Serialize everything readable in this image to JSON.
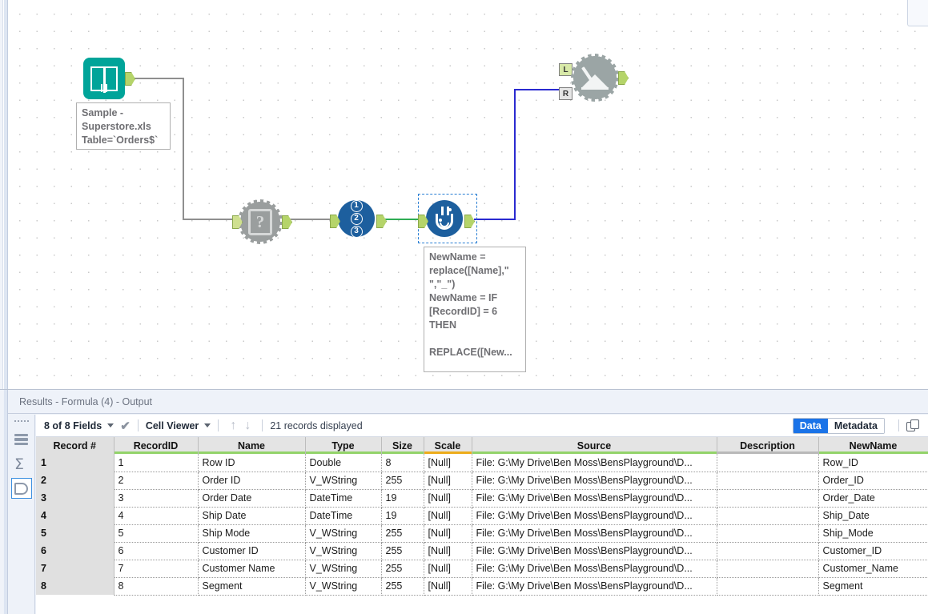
{
  "canvas": {
    "tools": [
      {
        "id": "input-data",
        "icon_name": "book-icon",
        "label": "Input Data"
      },
      {
        "id": "field-info",
        "icon_name": "question-gear-icon",
        "label": "Field Info"
      },
      {
        "id": "record-id",
        "icon_name": "record-id-icon",
        "label": "Record ID",
        "digits": [
          "1",
          "2",
          "3"
        ]
      },
      {
        "id": "formula",
        "icon_name": "flask-icon",
        "label": "Formula",
        "selected": true
      },
      {
        "id": "join",
        "icon_name": "join-gear-icon",
        "label": "Join",
        "inputs": [
          "L",
          "R"
        ]
      }
    ],
    "annotations": {
      "input": "Sample -\nSuperstore.xls\nTable=`Orders$`",
      "formula": "NewName =\nreplace([Name],\"\n\",\"_\")\nNewName = IF\n[RecordID] = 6\nTHEN\n\nREPLACE([New..."
    },
    "wire_colors": {
      "gray": "#8f8f8f",
      "green": "#2fad54",
      "blue": "#2a2ad0"
    }
  },
  "results": {
    "title": "Results - Formula (4) - Output",
    "toolbar": {
      "fields": "8 of 8 Fields",
      "viewer": "Cell Viewer",
      "records": "21 records displayed",
      "data_tab": "Data",
      "metadata_tab": "Metadata",
      "active_tab": "Data",
      "up_arrow": "↑",
      "down_arrow": "↓",
      "check": "✔"
    },
    "sidebar": [
      {
        "name": "table-view-icon",
        "selected": false
      },
      {
        "name": "summary-sigma-icon",
        "selected": false
      },
      {
        "name": "data-profile-icon",
        "selected": true
      }
    ],
    "columns": [
      {
        "label": "Record #",
        "underline": "none"
      },
      {
        "label": "RecordID",
        "underline": "green"
      },
      {
        "label": "Name",
        "underline": "green"
      },
      {
        "label": "Type",
        "underline": "green"
      },
      {
        "label": "Size",
        "underline": "green"
      },
      {
        "label": "Scale",
        "underline": "amber"
      },
      {
        "label": "Source",
        "underline": "green"
      },
      {
        "label": "Description",
        "underline": "gray"
      },
      {
        "label": "NewName",
        "underline": "green"
      }
    ],
    "rows": [
      [
        "1",
        "1",
        "Row ID",
        "Double",
        "8",
        "[Null]",
        "File: G:\\My Drive\\Ben Moss\\BensPlayground\\D...",
        "",
        "Row_ID"
      ],
      [
        "2",
        "2",
        "Order ID",
        "V_WString",
        "255",
        "[Null]",
        "File: G:\\My Drive\\Ben Moss\\BensPlayground\\D...",
        "",
        "Order_ID"
      ],
      [
        "3",
        "3",
        "Order Date",
        "DateTime",
        "19",
        "[Null]",
        "File: G:\\My Drive\\Ben Moss\\BensPlayground\\D...",
        "",
        "Order_Date"
      ],
      [
        "4",
        "4",
        "Ship Date",
        "DateTime",
        "19",
        "[Null]",
        "File: G:\\My Drive\\Ben Moss\\BensPlayground\\D...",
        "",
        "Ship_Date"
      ],
      [
        "5",
        "5",
        "Ship Mode",
        "V_WString",
        "255",
        "[Null]",
        "File: G:\\My Drive\\Ben Moss\\BensPlayground\\D...",
        "",
        "Ship_Mode"
      ],
      [
        "6",
        "6",
        "Customer ID",
        "V_WString",
        "255",
        "[Null]",
        "File: G:\\My Drive\\Ben Moss\\BensPlayground\\D...",
        "",
        "Customer_ID"
      ],
      [
        "7",
        "7",
        "Customer Name",
        "V_WString",
        "255",
        "[Null]",
        "File: G:\\My Drive\\Ben Moss\\BensPlayground\\D...",
        "",
        "Customer_Name"
      ],
      [
        "8",
        "8",
        "Segment",
        "V_WString",
        "255",
        "[Null]",
        "File: G:\\My Drive\\Ben Moss\\BensPlayground\\D...",
        "",
        "Segment"
      ]
    ]
  }
}
